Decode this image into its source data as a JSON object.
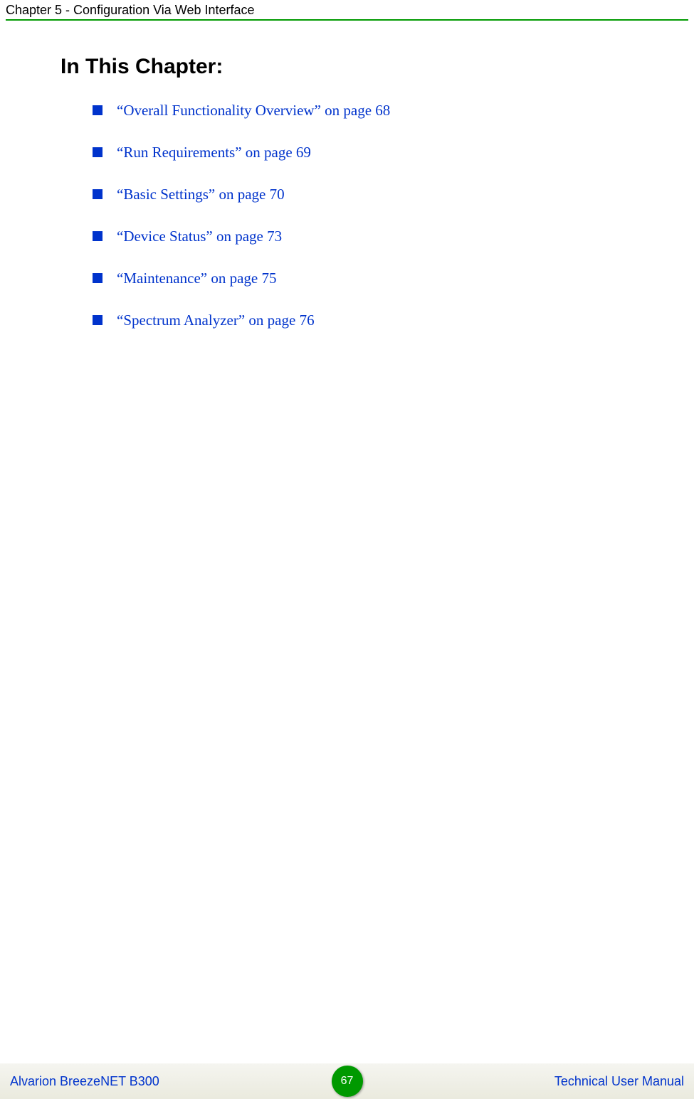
{
  "header": {
    "chapter_line": "Chapter 5 - Configuration Via Web Interface"
  },
  "title": "In This Chapter:",
  "toc": [
    "“Overall Functionality Overview” on page 68",
    "“Run Requirements” on page 69",
    "“Basic Settings” on page 70",
    "“Device Status” on page 73",
    "“Maintenance” on page 75",
    "“Spectrum Analyzer” on page 76"
  ],
  "footer": {
    "left": "Alvarion BreezeNET B300",
    "right": "Technical User Manual",
    "page": "67"
  }
}
